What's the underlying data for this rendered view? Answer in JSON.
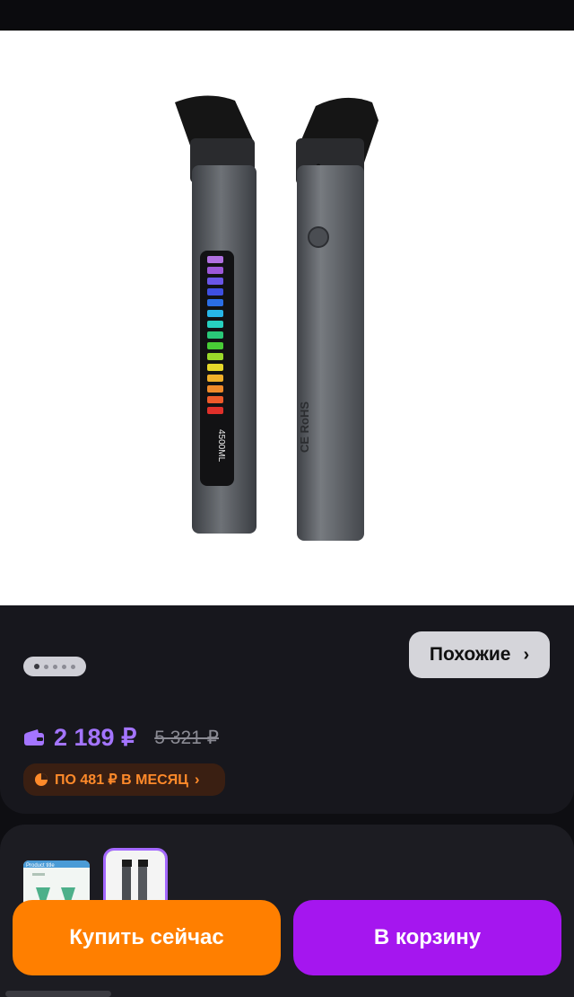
{
  "product": {
    "image_alt": "Электронный испаритель с LED-индикатором",
    "device_markings": {
      "capacity": "4500ML",
      "certifications": "CE RoHS"
    }
  },
  "gallery": {
    "total_dots": 5,
    "active_dot": 0
  },
  "similar": {
    "label": "Похожие"
  },
  "pricing": {
    "current_price": "2 189 ₽",
    "old_price": "5 321 ₽",
    "installment_label": "ПО 481 ₽ В МЕСЯЦ",
    "accent_color": "#a475ff"
  },
  "variants": {
    "thumb1_title": "Product title"
  },
  "actions": {
    "buy_now": "Купить сейчас",
    "add_to_cart": "В корзину"
  },
  "colors": {
    "buy": "#ff7f00",
    "cart": "#a516ef",
    "installment": "#ff8a2a"
  }
}
